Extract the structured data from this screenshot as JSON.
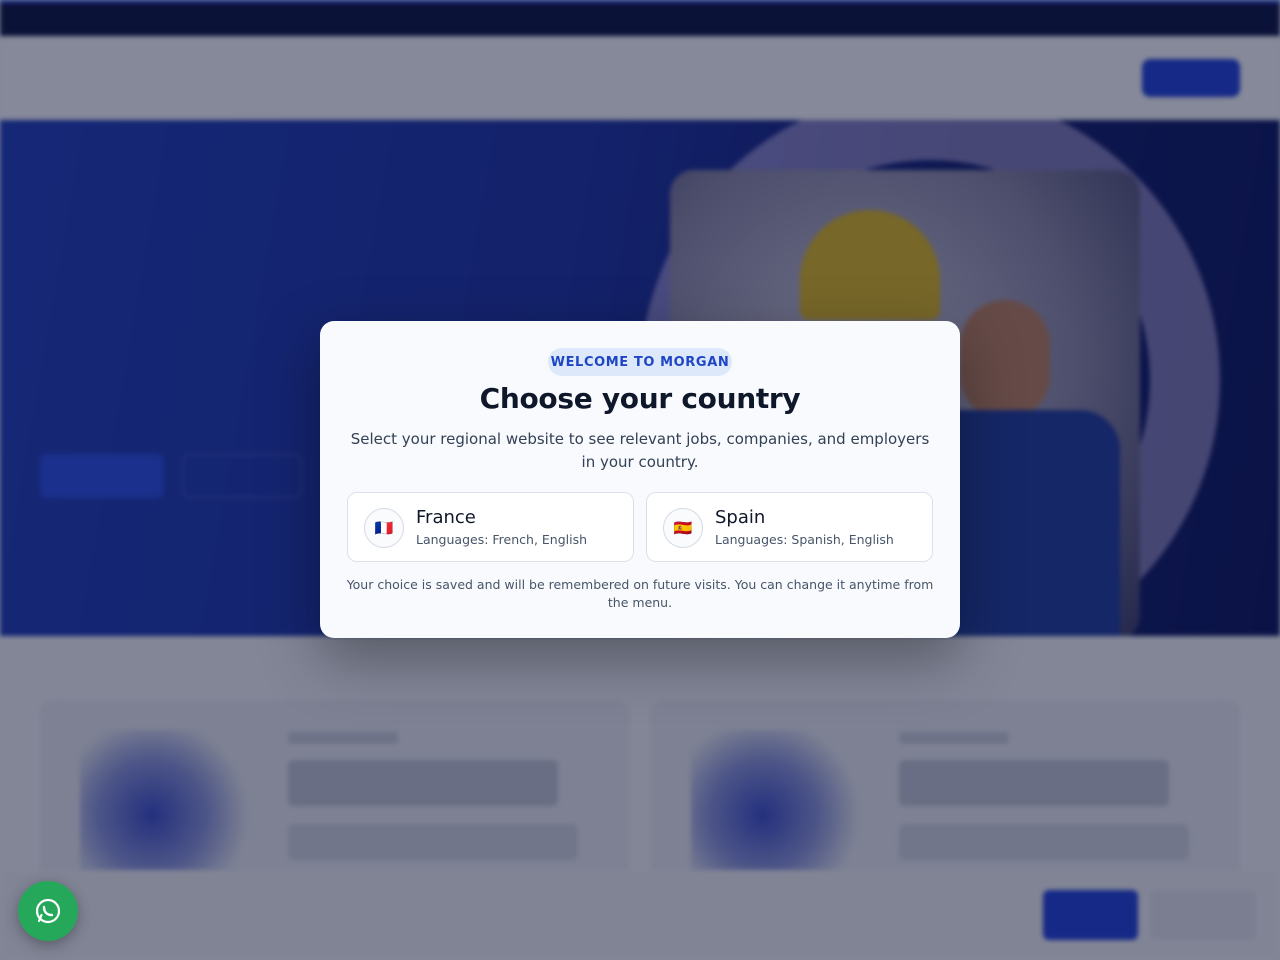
{
  "modal": {
    "badge": "WELCOME TO MORGAN",
    "title": "Choose your country",
    "description": "Select your regional website to see relevant jobs, companies, and employers in your country.",
    "countries": [
      {
        "name": "France",
        "languages": "Languages: French, English",
        "flag": "🇫🇷"
      },
      {
        "name": "Spain",
        "languages": "Languages: Spanish, English",
        "flag": "🇪🇸"
      }
    ],
    "footnote": "Your choice is saved and will be remembered on future visits. You can change it anytime from the menu."
  },
  "colors": {
    "accent": "#1e46c4",
    "badge_bg": "#dde8fb",
    "whatsapp": "#25a85a"
  },
  "icons": {
    "chat": "whatsapp-icon"
  }
}
